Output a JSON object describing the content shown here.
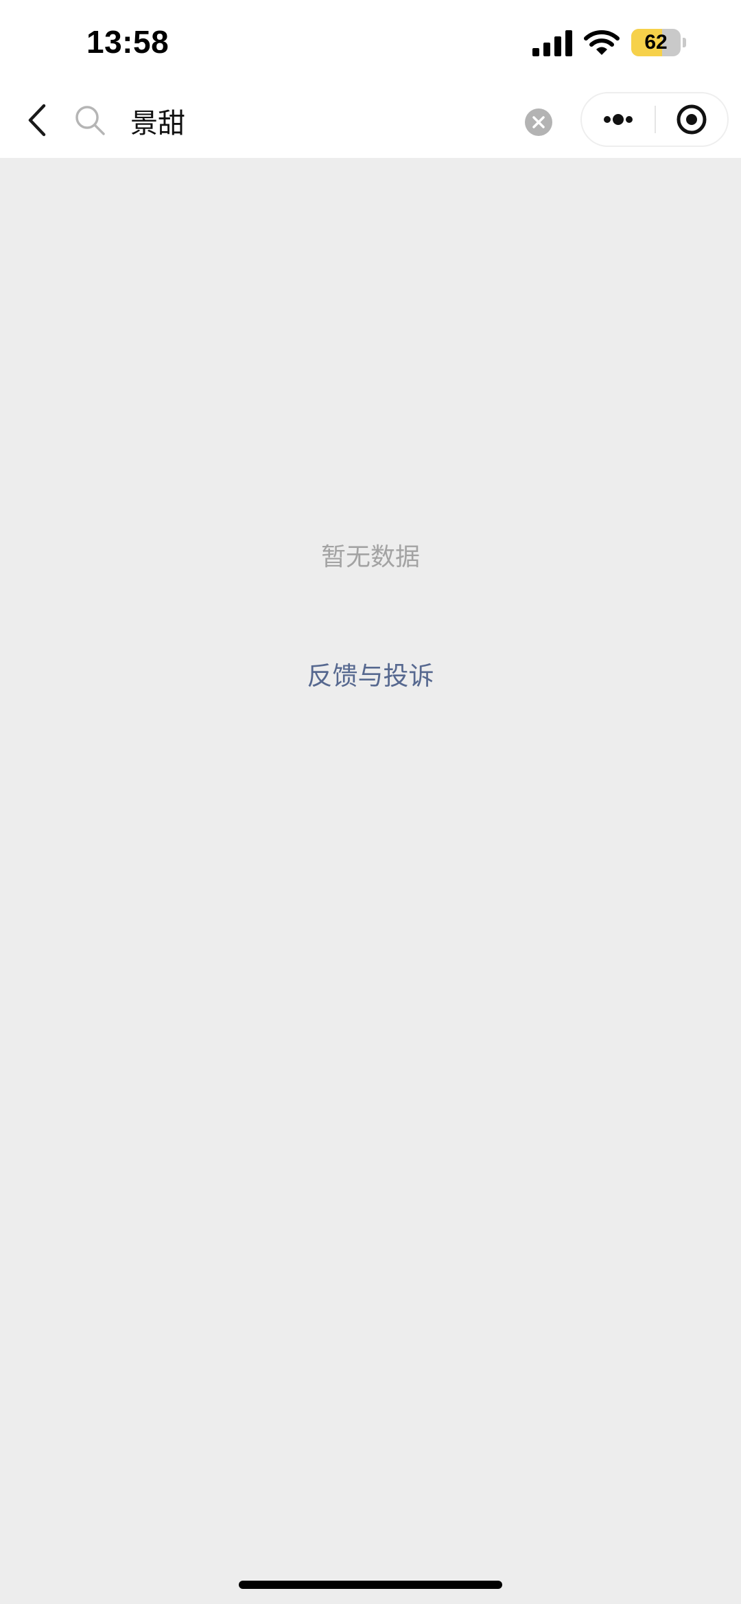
{
  "status_bar": {
    "time": "13:58",
    "battery_level": "62",
    "battery_fraction": 0.62,
    "icons": [
      "signal-icon",
      "wifi-icon",
      "battery-icon"
    ]
  },
  "nav": {
    "search_value": "景甜",
    "icons": [
      "chevron-left-icon",
      "search-icon",
      "clear-icon",
      "more-dots-icon",
      "close-target-icon"
    ]
  },
  "content": {
    "empty_message": "暂无数据",
    "feedback_link": "反馈与投诉"
  },
  "colors": {
    "background": "#ededed",
    "header": "#ffffff",
    "battery": "#f6d14a",
    "link": "#56688f",
    "muted_text": "#a3a3a3"
  }
}
